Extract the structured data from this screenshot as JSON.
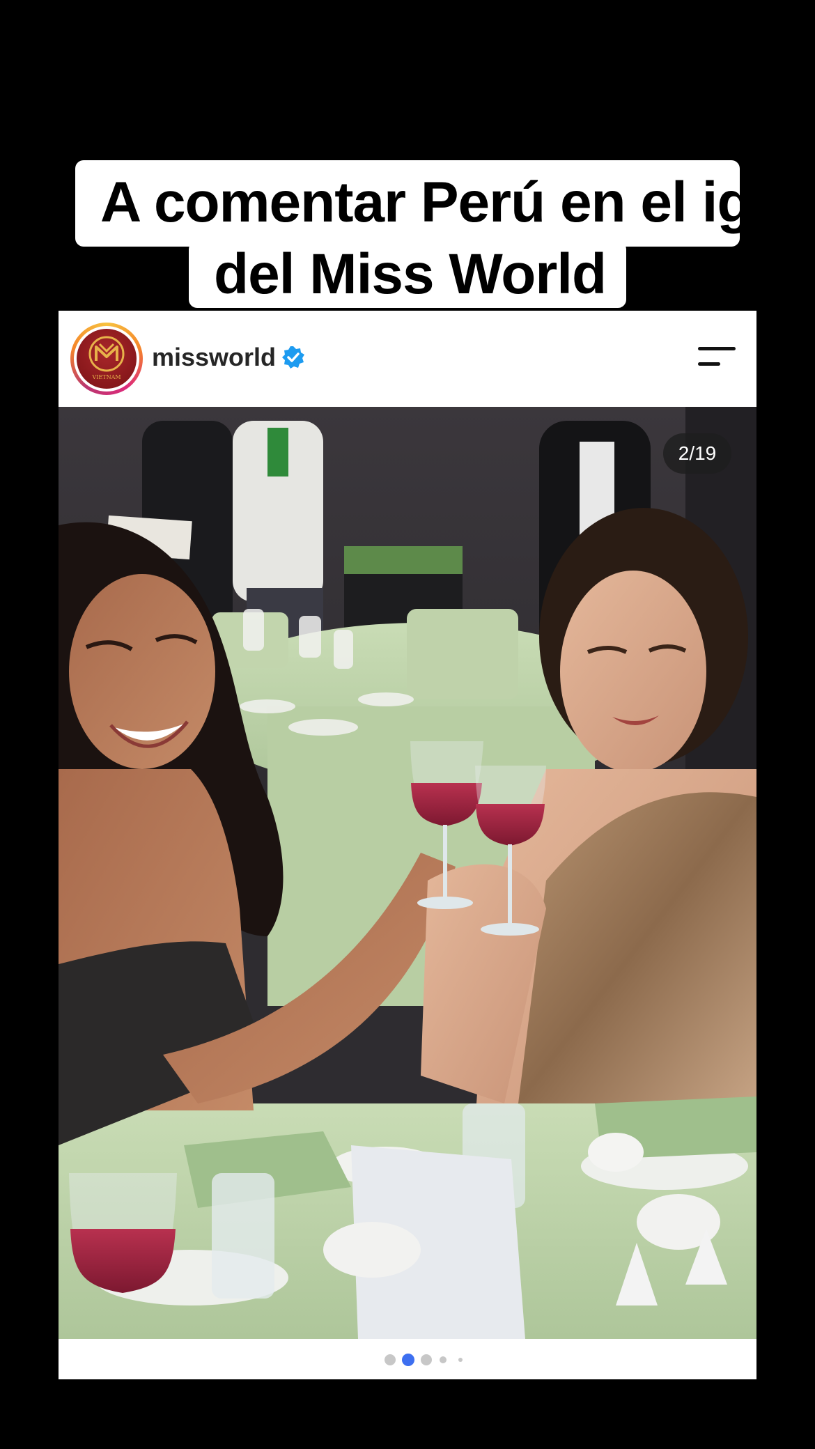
{
  "caption": {
    "line1": "A comentar Perú en el ig",
    "line2": "del Miss World"
  },
  "post": {
    "username": "missworld",
    "avatar_text": "VIETNAM",
    "verified_icon": "verified-badge-icon",
    "menu_icon": "menu-icon",
    "counter": "2/19",
    "current_slide": 2,
    "total_slides": 19,
    "dots_visible": 5,
    "active_dot_index": 1
  },
  "colors": {
    "background": "#000000",
    "card": "#ffffff",
    "verified": "#1d9bf0",
    "active_dot": "#3d6ff0",
    "inactive_dot": "#c7c7c7"
  }
}
